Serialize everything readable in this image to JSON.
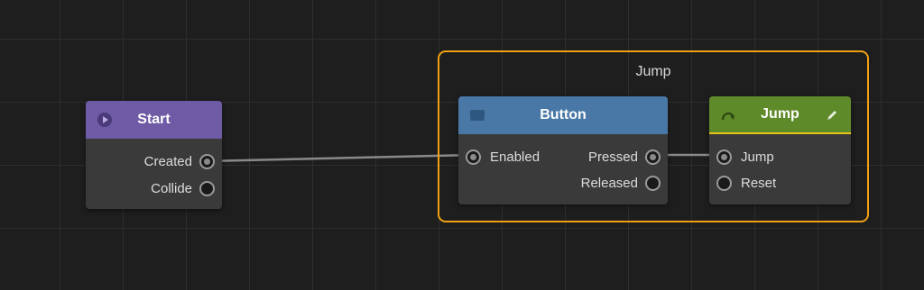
{
  "group": {
    "title": "Jump",
    "border_color": "#f0a013"
  },
  "nodes": {
    "start": {
      "title": "Start",
      "header_color": "#6e5aa5",
      "icon": "play-circle-icon",
      "outputs": [
        "Created",
        "Collide"
      ]
    },
    "button": {
      "title": "Button",
      "header_color": "#4a78a6",
      "icon": "button-icon",
      "inputs": [
        "Enabled"
      ],
      "outputs": [
        "Pressed",
        "Released"
      ]
    },
    "jump": {
      "title": "Jump",
      "header_color": "#5f8a2a",
      "accent_color": "#e6c21c",
      "icon": "jump-arrow-icon",
      "edit_icon": "pencil-icon",
      "inputs": [
        "Jump",
        "Reset"
      ]
    }
  },
  "connections": [
    {
      "from": "Start.Created",
      "to": "Button.Enabled"
    },
    {
      "from": "Button.Pressed",
      "to": "Jump.Jump"
    }
  ]
}
